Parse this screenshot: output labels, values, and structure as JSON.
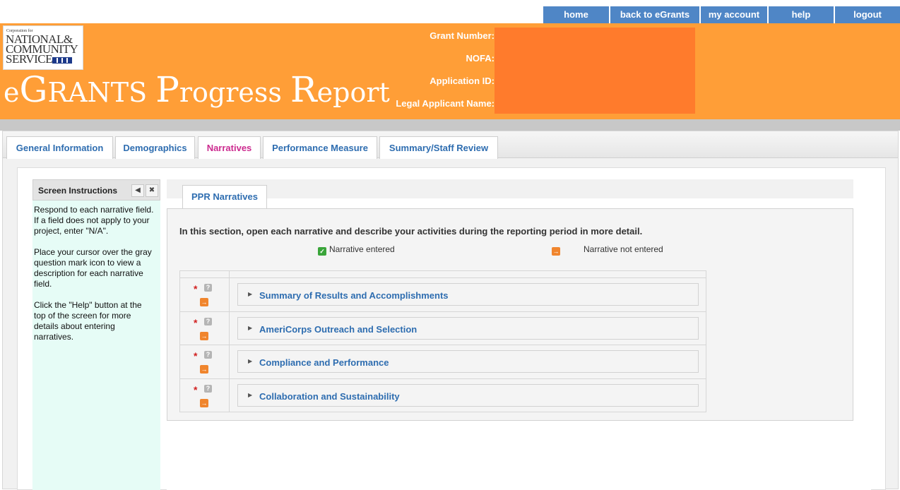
{
  "topnav": {
    "items": [
      {
        "label": "home"
      },
      {
        "label": "back to eGrants"
      },
      {
        "label": "my account"
      },
      {
        "label": "help"
      },
      {
        "label": "logout"
      }
    ],
    "color": "#4f86c6"
  },
  "header": {
    "logo": {
      "small": "Corporation for",
      "line1": "NATIONAL&",
      "line2": "COMMUNITY",
      "line3": "SERVICE"
    },
    "title_part1_initial": "e",
    "title_part1_big": "G",
    "title_part1_rest": "RANTS ",
    "title_part2_big": "P",
    "title_part2_rest": "rogress ",
    "title_part3_big": "R",
    "title_part3_rest": "eport",
    "fields": {
      "grant_number": "Grant Number:",
      "nofa": "NOFA:",
      "application_id": "Application ID:",
      "legal_applicant_name": "Legal Applicant Name:"
    },
    "background": "#ff9e37"
  },
  "tabs": [
    {
      "label": "General Information"
    },
    {
      "label": "Demographics"
    },
    {
      "label": "Narratives",
      "active": true
    },
    {
      "label": "Performance Measure"
    },
    {
      "label": "Summary/Staff Review"
    }
  ],
  "sidebar": {
    "title": "Screen Instructions",
    "paragraphs": [
      "Respond to each narrative field. If a field does not apply to your project, enter \"N/A\".",
      "Place your cursor over the gray question mark icon to view a description for each narrative field.",
      "Click the \"Help\" button at the top of the screen for more details about entering narratives."
    ]
  },
  "panel": {
    "tab_label": "PPR Narratives",
    "intro": "In this section, open each narrative and describe your activities during the reporting period in more detail.",
    "legend": {
      "entered": "Narrative entered",
      "not_entered": "Narrative not entered"
    },
    "narratives": [
      {
        "label": "Summary of Results and Accomplishments"
      },
      {
        "label": "AmeriCorps Outreach and Selection"
      },
      {
        "label": "Compliance and Performance"
      },
      {
        "label": "Collaboration and Sustainability"
      }
    ],
    "required_marker": "*",
    "help_glyph": "?"
  }
}
